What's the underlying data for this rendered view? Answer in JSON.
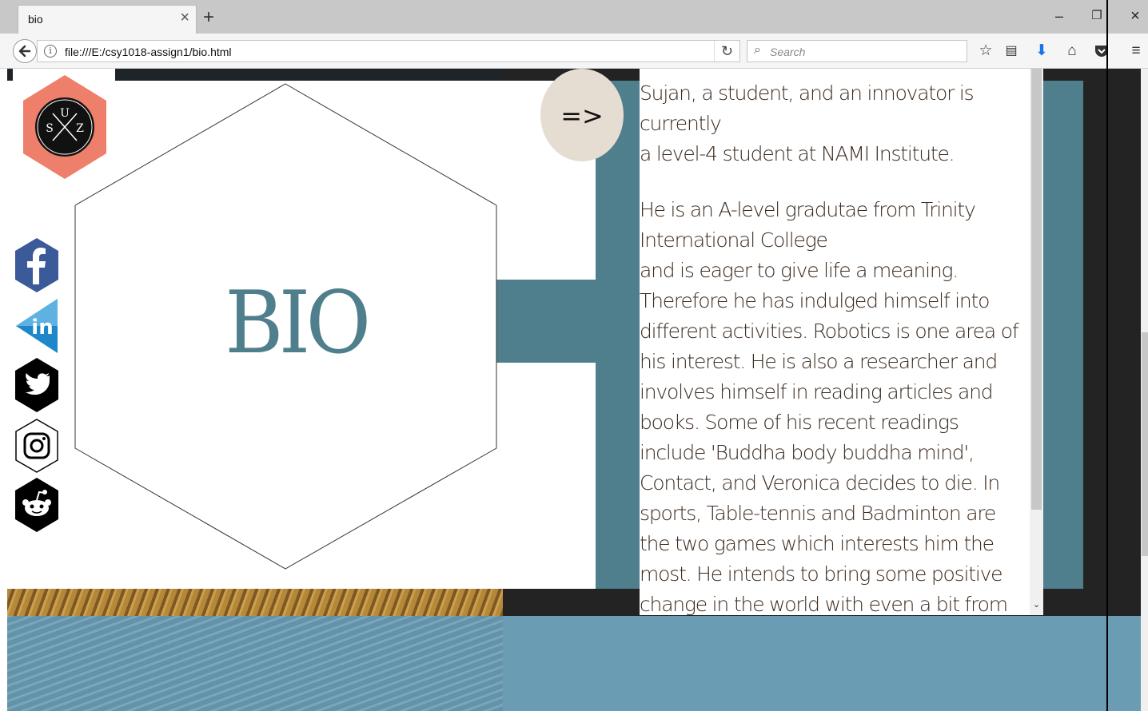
{
  "browser": {
    "tab_title": "bio",
    "tab_close_glyph": "×",
    "new_tab_glyph": "+",
    "url": "file:///E:/csy1018-assign1/bio.html",
    "search_placeholder": "Search",
    "window_controls": {
      "minimize": "–",
      "restore": "❐",
      "close": "×"
    },
    "toolbar_icons": [
      "star-icon",
      "reading-list-icon",
      "download-icon",
      "home-icon",
      "pocket-icon",
      "menu-icon"
    ]
  },
  "page": {
    "heading": "BIO",
    "logo_letters": {
      "top": "U",
      "left": "S",
      "right": "Z"
    },
    "next_button_label": "=>",
    "social_icons": [
      "facebook-icon",
      "linkedin-icon",
      "twitter-icon",
      "instagram-icon",
      "reddit-icon"
    ],
    "bio_paragraphs": [
      "Sujan, a student, and an innovator is currently\na level-4 student at NAMI Institute.",
      "He is an A-level gradutae from Trinity International College\nand is eager to give life a meaning. Therefore he has indulged himself into different activities. Robotics is one area of his interest. He is also a researcher and involves himself in reading articles and books. Some of his recent readings include 'Buddha body buddha mind', Contact, and Veronica decides to die. In sports, Table-tennis and Badminton are the two games which interests him the most. He intends to bring some positive change in the world with even a bit from his contribution. So he is a self-motivating guy who looks forward"
    ]
  },
  "colors": {
    "teal": "#4f7f8c",
    "logo_hex": "#ee7f6b",
    "next_button_bg": "#e6ddd2",
    "footer_blue": "#6a9cb3",
    "bio_text": "#3b2a1e"
  }
}
